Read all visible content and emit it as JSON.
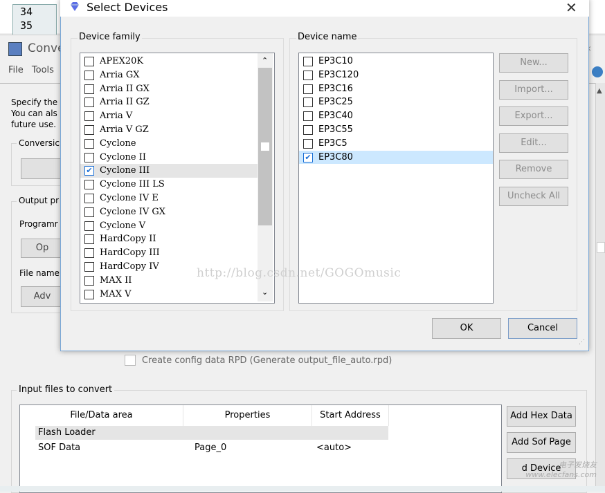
{
  "editor": {
    "lines": [
      "34",
      "35"
    ]
  },
  "conv": {
    "title": "Conve",
    "menu": [
      "File",
      "Tools"
    ],
    "desc": [
      "Specify the",
      "You can als",
      "future use."
    ],
    "group_conversion": "Conversic",
    "group_output": "Output pr",
    "programming_label": "Programr",
    "btn_op": "Op",
    "file_name_label": "File name",
    "btn_adv": "Adv",
    "create_rpd": "Create config data RPD (Generate output_file_auto.rpd)",
    "input_files_label": "Input files to convert",
    "table": {
      "headers": [
        "File/Data area",
        "Properties",
        "Start Address"
      ],
      "rows": [
        {
          "file": "Flash Loader",
          "props": "",
          "addr": ""
        },
        {
          "file": "SOF Data",
          "props": "Page_0",
          "addr": "<auto>"
        }
      ]
    },
    "side_buttons": [
      "Add Hex Data",
      "Add Sof Page",
      "d Device"
    ],
    "logo_text": "电子发烧友 www.elecfans.com"
  },
  "dialog": {
    "title": "Select Devices",
    "family_label": "Device family",
    "name_label": "Device name",
    "families": [
      {
        "label": "APEX20K",
        "checked": false
      },
      {
        "label": "Arria GX",
        "checked": false
      },
      {
        "label": "Arria II GX",
        "checked": false
      },
      {
        "label": "Arria II GZ",
        "checked": false
      },
      {
        "label": "Arria V",
        "checked": false
      },
      {
        "label": "Arria V GZ",
        "checked": false
      },
      {
        "label": "Cyclone",
        "checked": false
      },
      {
        "label": "Cyclone II",
        "checked": false
      },
      {
        "label": "Cyclone III",
        "checked": true
      },
      {
        "label": "Cyclone III LS",
        "checked": false
      },
      {
        "label": "Cyclone IV E",
        "checked": false
      },
      {
        "label": "Cyclone IV GX",
        "checked": false
      },
      {
        "label": "Cyclone V",
        "checked": false
      },
      {
        "label": "HardCopy II",
        "checked": false
      },
      {
        "label": "HardCopy III",
        "checked": false
      },
      {
        "label": "HardCopy IV",
        "checked": false
      },
      {
        "label": "MAX II",
        "checked": false
      },
      {
        "label": "MAX V",
        "checked": false
      }
    ],
    "devices": [
      {
        "label": "EP3C10",
        "checked": false
      },
      {
        "label": "EP3C120",
        "checked": false
      },
      {
        "label": "EP3C16",
        "checked": false
      },
      {
        "label": "EP3C25",
        "checked": false
      },
      {
        "label": "EP3C40",
        "checked": false
      },
      {
        "label": "EP3C55",
        "checked": false
      },
      {
        "label": "EP3C5",
        "checked": false
      },
      {
        "label": "EP3C80",
        "checked": true
      }
    ],
    "buttons": [
      "New...",
      "Import...",
      "Export...",
      "Edit...",
      "Remove",
      "Uncheck All"
    ],
    "ok": "OK",
    "cancel": "Cancel",
    "watermark": "http://blog.csdn.net/GOGOmusic"
  },
  "colors": {
    "accent": "#1a6fd6",
    "selected_row": "#cce8ff",
    "dialog_border": "#7aa7d6"
  }
}
